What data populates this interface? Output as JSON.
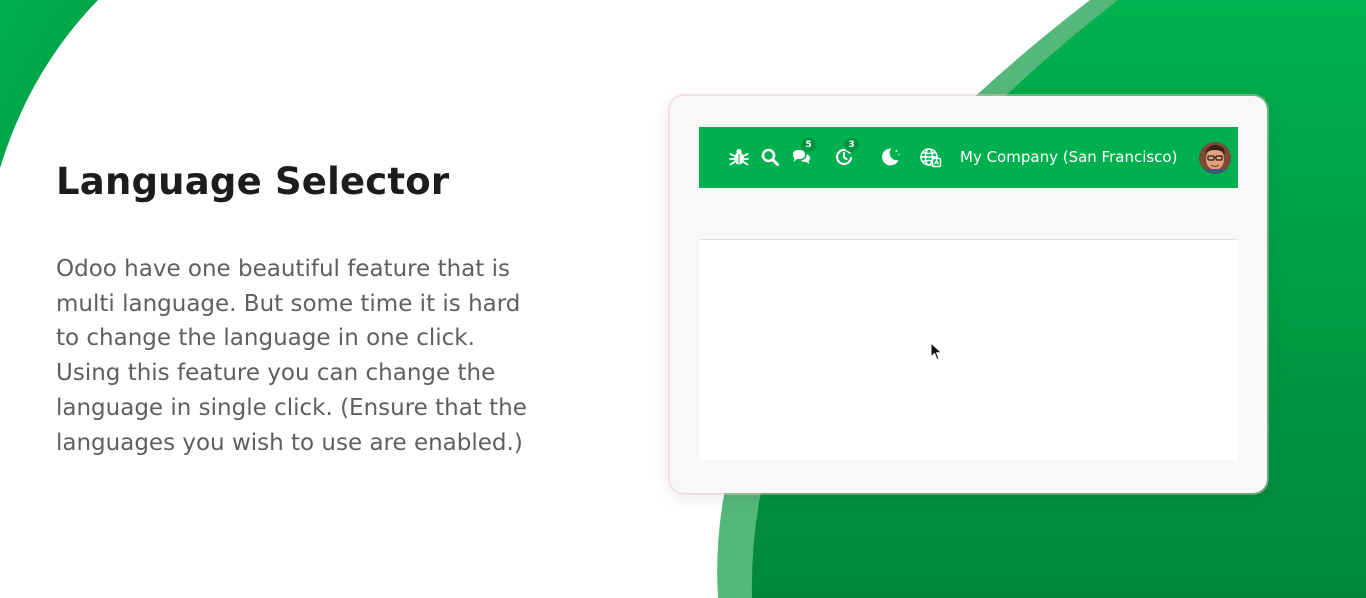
{
  "heading": "Language Selector",
  "description": {
    "lines": [
      "Odoo have one beautiful feature that is",
      "multi language. But some time it is hard",
      "to change the language in one click.",
      "Using this feature you can change the",
      "language in single click. (Ensure that the",
      "languages you wish to use are enabled.)"
    ]
  },
  "navbar": {
    "icons": [
      {
        "name": "bug-icon"
      },
      {
        "name": "search-icon"
      },
      {
        "name": "messages-icon",
        "badge": "5"
      },
      {
        "name": "activity-icon",
        "badge": "3"
      },
      {
        "name": "dark-mode-moon-icon"
      },
      {
        "name": "language-globe-icon"
      }
    ],
    "company": "My Company (San Francisco)"
  },
  "colors": {
    "brand_green": "#00b04f",
    "brand_green_dark": "#00963f",
    "text_dark": "#1c1c1c",
    "text_body": "#5f5f5f"
  }
}
